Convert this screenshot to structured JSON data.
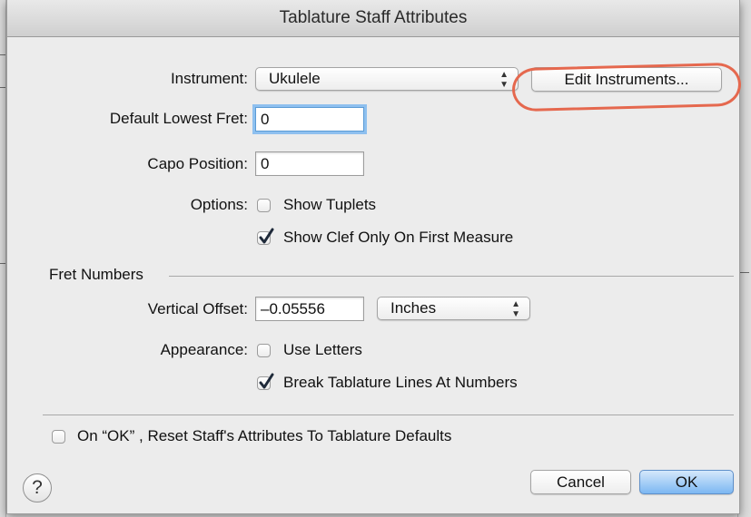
{
  "dialog": {
    "title": "Tablature Staff Attributes"
  },
  "instrument": {
    "label": "Instrument:",
    "selected": "Ukulele",
    "edit_button": "Edit Instruments..."
  },
  "default_lowest_fret": {
    "label": "Default Lowest Fret:",
    "value": "0"
  },
  "capo_position": {
    "label": "Capo Position:",
    "value": "0"
  },
  "options": {
    "label": "Options:",
    "show_tuplets": {
      "label": "Show Tuplets",
      "checked": false
    },
    "show_clef": {
      "label": "Show Clef Only On First Measure",
      "checked": true
    }
  },
  "fret_numbers": {
    "section_title": "Fret Numbers",
    "vertical_offset": {
      "label": "Vertical Offset:",
      "value": "–0.05556",
      "unit": "Inches"
    },
    "appearance": {
      "label": "Appearance:",
      "use_letters": {
        "label": "Use Letters",
        "checked": false
      },
      "break_lines": {
        "label": "Break Tablature Lines At Numbers",
        "checked": true
      }
    }
  },
  "reset": {
    "label": "On “OK” , Reset Staff's Attributes To Tablature Defaults",
    "checked": false
  },
  "footer": {
    "help": "?",
    "cancel": "Cancel",
    "ok": "OK"
  },
  "colors": {
    "annotation": "#e5684e",
    "accent": "#7cb7f2",
    "dialog_bg": "#ececec"
  }
}
